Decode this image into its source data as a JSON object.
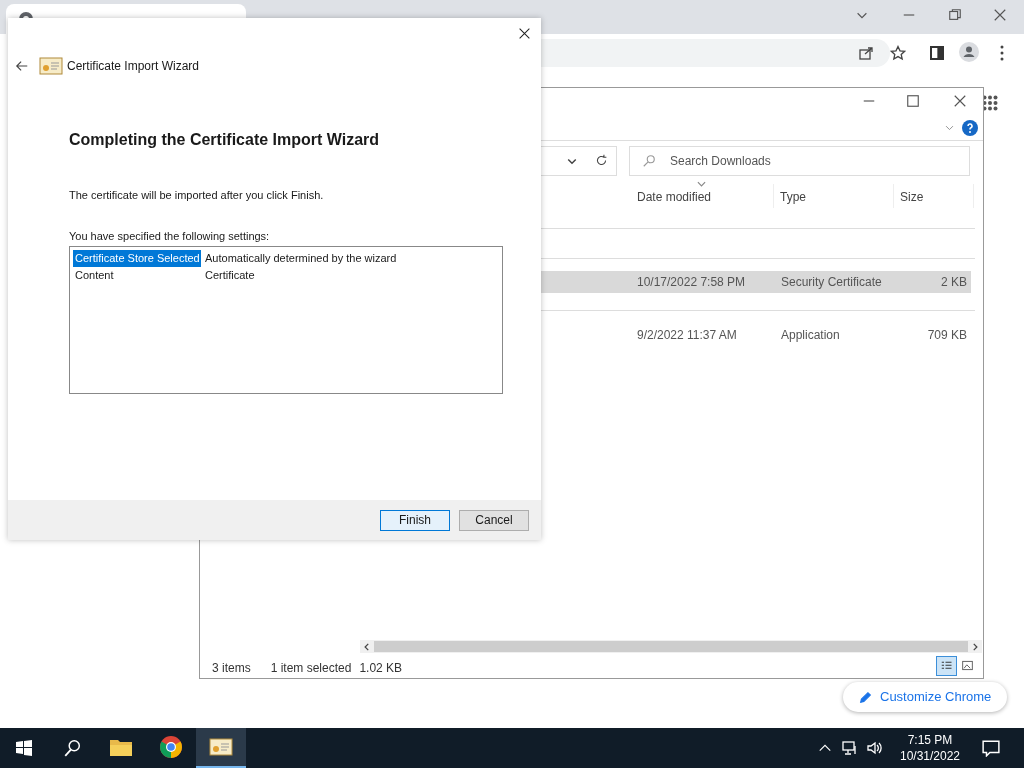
{
  "browser": {
    "customize_button": "Customize Chrome"
  },
  "explorer": {
    "search_placeholder": "Search Downloads",
    "columns": [
      "Date modified",
      "Type",
      "Size"
    ],
    "rows": [
      {
        "date": "10/17/2022 7:58 PM",
        "type": "Security Certificate",
        "size": "2 KB",
        "selected": true
      },
      {
        "date": "9/2/2022 11:37 AM",
        "type": "Application",
        "size": "709 KB",
        "selected": false
      }
    ],
    "status": {
      "count": "3 items",
      "selection": "1 item selected",
      "size": "1.02 KB"
    }
  },
  "wizard": {
    "title": "Certificate Import Wizard",
    "heading": "Completing the Certificate Import Wizard",
    "message": "The certificate will be imported after you click Finish.",
    "settings_label": "You have specified the following settings:",
    "settings": [
      {
        "name": "Certificate Store Selected",
        "value": "Automatically determined by the wizard",
        "selected": true
      },
      {
        "name": "Content",
        "value": "Certificate",
        "selected": false
      }
    ],
    "buttons": [
      {
        "label": "Finish",
        "kind": "primary"
      },
      {
        "label": "Cancel",
        "kind": "secondary"
      }
    ]
  },
  "taskbar": {
    "apps": [
      {
        "kind": "explorer",
        "selected": false
      },
      {
        "kind": "chrome",
        "selected": false
      },
      {
        "kind": "certificate",
        "selected": true
      }
    ],
    "time": "7:15 PM",
    "date": "10/31/2022"
  }
}
